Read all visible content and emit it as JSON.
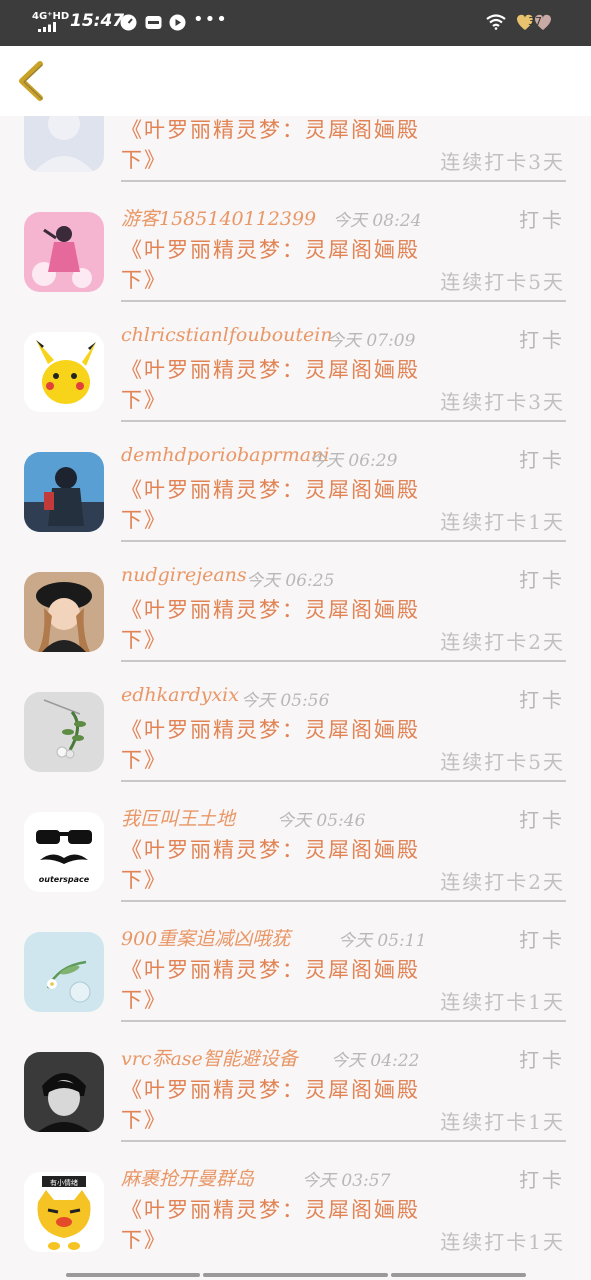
{
  "status_bar": {
    "network": "4G⁺HD",
    "time": "15:47",
    "dots": "•••",
    "battery": "37",
    "icons": [
      "signal-icon",
      "speedometer-icon",
      "app-icon",
      "play-icon",
      "wifi-icon",
      "battery-icon"
    ]
  },
  "nav": {
    "back_icon": "chevron-left-icon"
  },
  "feed": {
    "items": [
      {
        "user": "",
        "time": "",
        "action": "",
        "title": "《叶罗丽精灵梦：灵犀阁婳殿下》",
        "streak": "连续打卡3天"
      },
      {
        "user": "游客1585140112399",
        "time": "今天 08:24",
        "action": "打卡",
        "title": "《叶罗丽精灵梦：灵犀阁婳殿下》",
        "streak": "连续打卡5天"
      },
      {
        "user": "chlricstianlfouboutein",
        "time": "今天 07:09",
        "action": "打卡",
        "title": "《叶罗丽精灵梦：灵犀阁婳殿下》",
        "streak": "连续打卡3天"
      },
      {
        "user": "demhdporiobaprmani",
        "time": "今天 06:29",
        "action": "打卡",
        "title": "《叶罗丽精灵梦：灵犀阁婳殿下》",
        "streak": "连续打卡1天"
      },
      {
        "user": "nudgirejeans",
        "time": "今天 06:25",
        "action": "打卡",
        "title": "《叶罗丽精灵梦：灵犀阁婳殿下》",
        "streak": "连续打卡2天"
      },
      {
        "user": "edhkardyxix",
        "time": "今天 05:56",
        "action": "打卡",
        "title": "《叶罗丽精灵梦：灵犀阁婳殿下》",
        "streak": "连续打卡5天"
      },
      {
        "user": "我叵叫王土地",
        "time": "今天 05:46",
        "action": "打卡",
        "title": "《叶罗丽精灵梦：灵犀阁婳殿下》",
        "streak": "连续打卡2天",
        "avatar_text": "outerspace"
      },
      {
        "user": "900重案追减凶哦莸",
        "time": "今天 05:11",
        "action": "打卡",
        "title": "《叶罗丽精灵梦：灵犀阁婳殿下》",
        "streak": "连续打卡1天"
      },
      {
        "user": "vrc忝ase智能避设备",
        "time": "今天 04:22",
        "action": "打卡",
        "title": "《叶罗丽精灵梦：灵犀阁婳殿下》",
        "streak": "连续打卡1天"
      },
      {
        "user": "麻裹抢开曼群岛",
        "time": "今天 03:57",
        "action": "打卡",
        "title": "《叶罗丽精灵梦：灵犀阁婳殿下》",
        "streak": "连续打卡1天",
        "avatar_text": "有小情绪"
      }
    ]
  },
  "colors": {
    "title": "#e18354",
    "username": "#e99767",
    "meta": "#b8b8b8",
    "status_bg": "#3c3c3c",
    "back_arrow": "#c9a227"
  }
}
